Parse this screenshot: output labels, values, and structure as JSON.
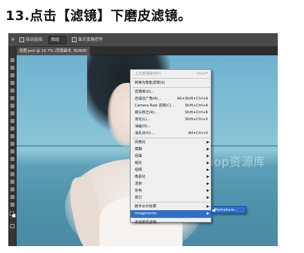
{
  "page": {
    "heading": "13.点击【滤镜】下磨皮滤镜。"
  },
  "toolbar": {
    "auto_select_label": "自动选择:",
    "auto_select_value": "图层",
    "align_label": "显示变换控件"
  },
  "document_tab": {
    "title": "原图.psd @ 16.7% (背景副本, RGB/8)"
  },
  "watermark": "@photoshop资源库",
  "filter_menu": {
    "items": [
      {
        "label": "上次滤镜操作(F)",
        "shortcut": "Ctrl+F",
        "dim": true
      },
      {
        "label": "转换为智能滤镜(S)",
        "shortcut": ""
      },
      {
        "label": "滤镜库(G)...",
        "shortcut": ""
      },
      {
        "label": "自适应广角(A)...",
        "shortcut": "Alt+Shift+Ctrl+A"
      },
      {
        "label": "Camera Raw 滤镜(C)...",
        "shortcut": "Shift+Ctrl+A"
      },
      {
        "label": "镜头校正(R)...",
        "shortcut": "Shift+Ctrl+R"
      },
      {
        "label": "液化(L)...",
        "shortcut": "Shift+Ctrl+X"
      },
      {
        "label": "油画(O)...",
        "shortcut": ""
      },
      {
        "label": "消失点(V)...",
        "shortcut": "Alt+Ctrl+V"
      },
      {
        "label": "风格化",
        "submenu": true
      },
      {
        "label": "模糊",
        "submenu": true
      },
      {
        "label": "扭曲",
        "submenu": true
      },
      {
        "label": "锐化",
        "submenu": true
      },
      {
        "label": "视频",
        "submenu": true
      },
      {
        "label": "像素化",
        "submenu": true
      },
      {
        "label": "渲染",
        "submenu": true
      },
      {
        "label": "杂色",
        "submenu": true
      },
      {
        "label": "其它",
        "submenu": true
      },
      {
        "label": "数字水印效果",
        "submenu": true
      },
      {
        "label": "Imagenomic",
        "submenu": true,
        "highlighted": true
      },
      {
        "label": "浏览联机滤镜...",
        "shortcut": ""
      }
    ]
  },
  "submenu": {
    "item": "Portraiture..."
  },
  "colors": {
    "menu_highlight": "#2f6fc7",
    "ui_dark": "#3c3c3c"
  }
}
